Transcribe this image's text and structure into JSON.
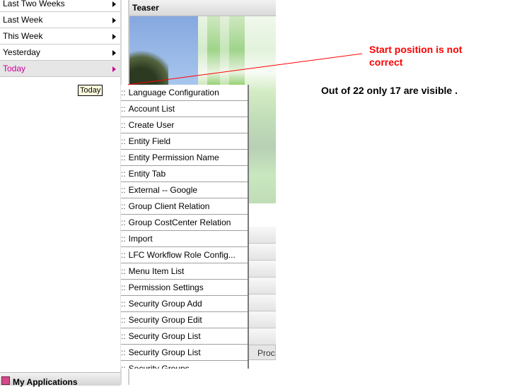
{
  "left_menu": {
    "items": [
      {
        "label": "Last Two Weeks"
      },
      {
        "label": "Last Week"
      },
      {
        "label": "This Week"
      },
      {
        "label": "Yesterday"
      },
      {
        "label": "Today"
      }
    ]
  },
  "teaser": {
    "title": "Teaser",
    "process_label": "Proce"
  },
  "tooltip": {
    "text": "Today"
  },
  "dropdown": {
    "prefix": "::",
    "items": [
      {
        "label": "Language Configuration"
      },
      {
        "label": "Account List"
      },
      {
        "label": "Create User"
      },
      {
        "label": "Entity Field"
      },
      {
        "label": "Entity Permission Name"
      },
      {
        "label": "Entity Tab"
      },
      {
        "label": "External -- Google"
      },
      {
        "label": "Group Client Relation"
      },
      {
        "label": "Group CostCenter Relation"
      },
      {
        "label": "Import"
      },
      {
        "label": "LFC Workflow Role Config..."
      },
      {
        "label": "Menu Item List"
      },
      {
        "label": "Permission Settings"
      },
      {
        "label": "Security Group Add"
      },
      {
        "label": "Security Group Edit"
      },
      {
        "label": "Security Group List"
      },
      {
        "label": "Security Group List"
      },
      {
        "label": "Security Groups"
      }
    ]
  },
  "bottom": {
    "apps_label": "My Applications"
  },
  "annotations": {
    "start_position": "Start position is not\ncorrect",
    "visible_note": "Out of 22 only 17 are visible ."
  },
  "colors": {
    "active_item": "#cc0099",
    "annotation": "#ff0000",
    "tooltip_bg": "#ffffe1"
  }
}
